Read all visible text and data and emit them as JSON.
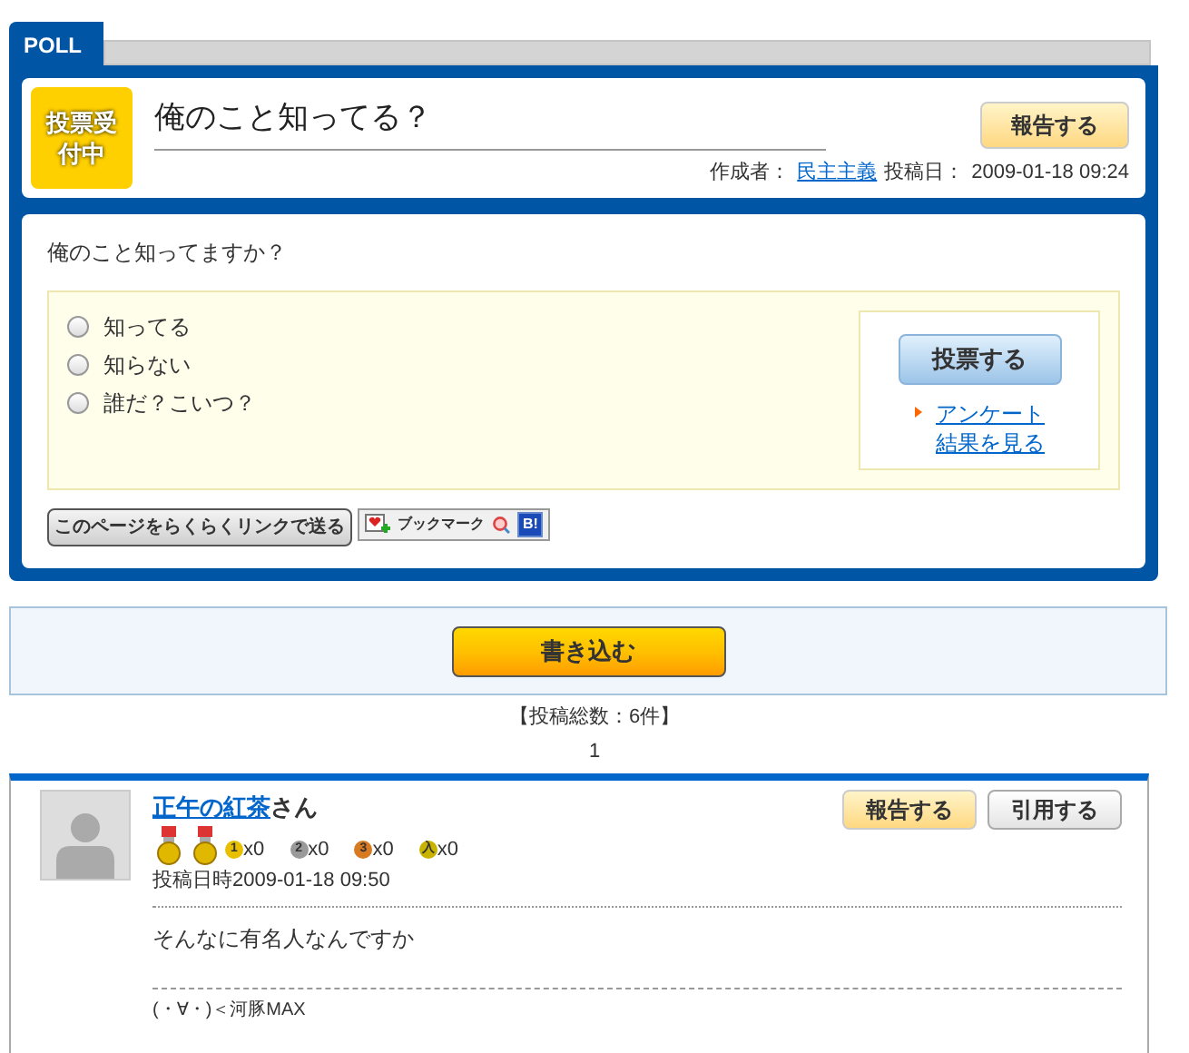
{
  "poll": {
    "tab": "POLL",
    "status_badge": "投票受付中",
    "title": "俺のこと知ってる？",
    "report_button": "報告する",
    "author_label": "作成者：",
    "author": "民主主義",
    "date_label": "投稿日：",
    "date": "2009-01-18 09:24",
    "question": "俺のこと知ってますか？",
    "options": [
      {
        "label": "知ってる",
        "selected": false
      },
      {
        "label": "知らない",
        "selected": false
      },
      {
        "label": "誰だ？こいつ？",
        "selected": false
      }
    ],
    "vote_button": "投票する",
    "results_link": "アンケート結果を見る",
    "share_button": "このページをらくらくリンクで送る",
    "bookmark_button": "ブックマーク",
    "bookmark_badge": "B!"
  },
  "write_button": "書き込む",
  "total_posts": "【投稿総数：6件】",
  "page": "1",
  "posts": [
    {
      "author": "正午の紅茶",
      "honorific": "さん",
      "medals": [
        {
          "label": "1",
          "color": "#e8c000",
          "count": "x0"
        },
        {
          "label": "2",
          "color": "#9a9a9a",
          "count": "x0"
        },
        {
          "label": "3",
          "color": "#d87a20",
          "count": "x0"
        },
        {
          "label": "入",
          "color": "#c8b400",
          "count": "x0"
        }
      ],
      "date_label": "投稿日時",
      "date": "2009-01-18 09:50",
      "report_button": "報告する",
      "quote_button": "引用する",
      "body": "そんなに有名人なんですか",
      "signature": "(・∀・)＜河豚MAX"
    }
  ]
}
